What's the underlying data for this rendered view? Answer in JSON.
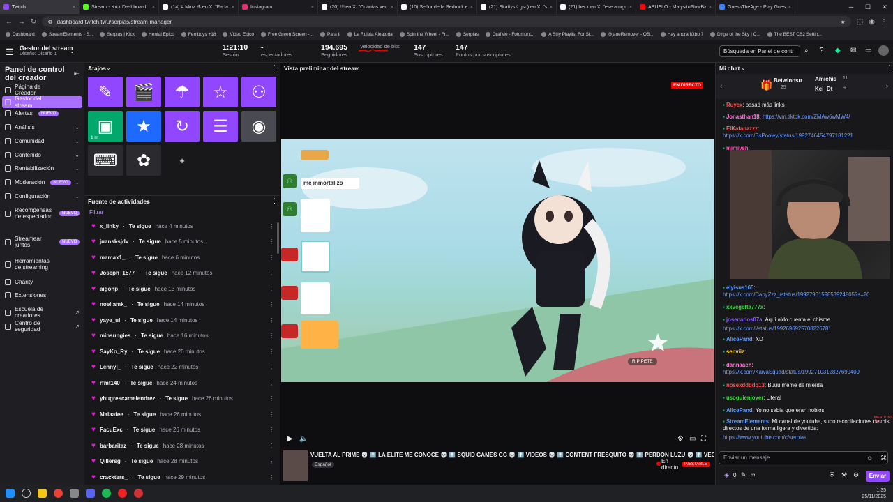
{
  "browser": {
    "tabs": [
      {
        "title": "Twitch",
        "color": "#9147ff",
        "active": true
      },
      {
        "title": "Stream - Kick Dashboard",
        "color": "#53fc18"
      },
      {
        "title": "(14) # Miriz ᴹᴸ en X: \"Farfa",
        "color": "#ffffff"
      },
      {
        "title": "Instagram",
        "color": "#e1306c"
      },
      {
        "title": "(20) ᵀᴴ en X: \"Cuántas vec",
        "color": "#ffffff"
      },
      {
        "title": "(10) Señor de la Bedrock en X",
        "color": "#ffffff"
      },
      {
        "title": "(21) Skattys ᵒ gsc) en X: \"sp",
        "color": "#ffffff"
      },
      {
        "title": "(21) beck en X: \"ese amigo m",
        "color": "#ffffff"
      },
      {
        "title": "ABUELO - MatysitoFlowBaks",
        "color": "#ff0000"
      },
      {
        "title": "GuessTheAge - Play Guess Th",
        "color": "#3b82f6"
      }
    ],
    "url": "dashboard.twitch.tv/u/serpias/stream-manager",
    "bookmarks": [
      "Dashboard",
      "StreamElements - S...",
      "Serpias | Kick",
      "Hentai Epico",
      "Femboys +18",
      "Video Epico",
      "Free Green Screen -...",
      "Para ti",
      "La Ruleta Aleatoria",
      "Spin the Wheel - Fr...",
      "Serpias",
      "GrafMe - Fotomont...",
      "A Silly Playlist For Si...",
      "@janeRemover - OB...",
      "Hay ahora fútbol?",
      "Dirge of the Sky | C...",
      "The BEST CS2 Settin..."
    ]
  },
  "topbar": {
    "title": "Gestor del stream",
    "subtitle": "Diseño: Diseño 1",
    "stats": [
      {
        "value": "1:21:10",
        "label": "Sesión"
      },
      {
        "value": "-",
        "label": "espectadores"
      },
      {
        "value": "194.695",
        "label": "Seguidores"
      },
      {
        "value": "",
        "label": "Velocidad de bits"
      },
      {
        "value": "147",
        "label": "Suscriptores"
      },
      {
        "value": "147",
        "label": "Puntos por suscriptores"
      }
    ],
    "search_placeholder": "Búsqueda en Panel de contr"
  },
  "sidebar": {
    "title": "Panel de control del creador",
    "items": [
      {
        "label": "Página de Creador"
      },
      {
        "label": "Gestor del stream",
        "active": true
      },
      {
        "label": "Alertas",
        "badge": "NUEVO"
      },
      {
        "label": "Análisis",
        "chevron": true
      },
      {
        "label": "Comunidad",
        "chevron": true
      },
      {
        "label": "Contenido",
        "chevron": true
      },
      {
        "label": "Rentabilización",
        "chevron": true
      },
      {
        "label": "Moderación",
        "badge": "NUEVO",
        "chevron": true
      },
      {
        "label": "Configuración",
        "chevron": true
      },
      {
        "label": "Recompensas de espectador",
        "badge": "NUEVO",
        "chevron": true
      },
      {
        "label": "Streamear juntos",
        "badge": "NUEVO"
      },
      {
        "label": "Herramientas de streaming"
      },
      {
        "label": "Charity"
      },
      {
        "label": "Extensiones"
      },
      {
        "label": "Escuela de creadores",
        "external": true
      },
      {
        "label": "Centro de seguridad",
        "external": true
      }
    ]
  },
  "shortcuts": {
    "title": "Atajos",
    "tiles": [
      {
        "icon": "pencil-icon",
        "glyph": "✎",
        "color": "#9147ff"
      },
      {
        "icon": "clapperboard-icon",
        "glyph": "🎬",
        "color": "#9147ff"
      },
      {
        "icon": "parachute-icon",
        "glyph": "☂",
        "color": "#9147ff"
      },
      {
        "icon": "star-outline-icon",
        "glyph": "☆",
        "color": "#9147ff"
      },
      {
        "icon": "add-user-icon",
        "glyph": "⚇",
        "color": "#9147ff"
      },
      {
        "icon": "ad-icon",
        "glyph": "▣",
        "color": "#00a86b",
        "caption": "1 m"
      },
      {
        "icon": "star-icon",
        "glyph": "★",
        "color": "#1e69ff"
      },
      {
        "icon": "restart-icon",
        "glyph": "↻",
        "color": "#9147ff"
      },
      {
        "icon": "layout-icon",
        "glyph": "☰",
        "color": "#9147ff"
      },
      {
        "icon": "podcast-icon",
        "glyph": "◉",
        "color": "#4a4a52"
      },
      {
        "icon": "chat-bot-icon",
        "glyph": "⌨",
        "color": "#2a2a2f"
      },
      {
        "icon": "kick-extension-icon",
        "glyph": "✿",
        "color": "#2a2a2f"
      }
    ],
    "add_label": "+"
  },
  "activity": {
    "title": "Fuente de actividades",
    "filter": "Filtrar",
    "events": [
      {
        "user": "x_linky",
        "action": "Te sigue",
        "time": "hace 4 minutos"
      },
      {
        "user": "juansksjdv",
        "action": "Te sigue",
        "time": "hace 5 minutos"
      },
      {
        "user": "mamax1_",
        "action": "Te sigue",
        "time": "hace 6 minutos"
      },
      {
        "user": "Joseph_1577",
        "action": "Te sigue",
        "time": "hace 12 minutos"
      },
      {
        "user": "aigohp",
        "action": "Te sigue",
        "time": "hace 13 minutos"
      },
      {
        "user": "noeliamk_",
        "action": "Te sigue",
        "time": "hace 14 minutos"
      },
      {
        "user": "yaye_ul",
        "action": "Te sigue",
        "time": "hace 14 minutos"
      },
      {
        "user": "minsungies",
        "action": "Te sigue",
        "time": "hace 16 minutos"
      },
      {
        "user": "SayKo_Ry",
        "action": "Te sigue",
        "time": "hace 20 minutos"
      },
      {
        "user": "Lennyl_",
        "action": "Te sigue",
        "time": "hace 22 minutos"
      },
      {
        "user": "rfmt140",
        "action": "Te sigue",
        "time": "hace 24 minutos"
      },
      {
        "user": "yhugrescamelendrez",
        "action": "Te sigue",
        "time": "hace 26 minutos"
      },
      {
        "user": "Malaafee",
        "action": "Te sigue",
        "time": "hace 26 minutos"
      },
      {
        "user": "FacuExc",
        "action": "Te sigue",
        "time": "hace 26 minutos"
      },
      {
        "user": "barbaritaz",
        "action": "Te sigue",
        "time": "hace 28 minutos"
      },
      {
        "user": "Qillersg",
        "action": "Te sigue",
        "time": "hace 28 minutos"
      },
      {
        "user": "crackters_",
        "action": "Te sigue",
        "time": "hace 29 minutos"
      }
    ]
  },
  "preview": {
    "title": "Vista preliminar del stream",
    "live_badge": "EN DIRECTO",
    "overlay_text": "me inmortalizo",
    "rip_text": "RIP PETE",
    "stream_title": "VUELTA AL PRIME 💀 ⬆️ LA ELITE ME CONOCE 💀 ⬆️ SQUID GAMES GG 💀 ⬆️ VIDEOS 💀 ⬆️ CONTENT FRESQUITO 💀 ⬆️ PERDON LUZU 💀 ⬆️ VEGETTA M",
    "language": "Español",
    "status": "En directo",
    "unstable": "INESTABLE"
  },
  "chat": {
    "title": "Mi chat",
    "gifters": [
      {
        "name": "Betwinosu",
        "count": "25"
      },
      {
        "name": "Amichis",
        "count": "11"
      },
      {
        "name": "Kei_Dt",
        "count": "9"
      }
    ],
    "messages": [
      {
        "user": "Ruycx",
        "color": "#ff4f4f",
        "text": "pasad más links"
      },
      {
        "user": "Jonasthan18",
        "color": "#ff7ad9",
        "text": "https://vm.tiktok.com/ZMAw6wMW4/",
        "link": true
      },
      {
        "user": "ElKatanazzz",
        "color": "#ff6b6b",
        "text": "https://x.com/BsPooley/status/1992746454797181221",
        "link": true
      },
      {
        "user": "mimivsh",
        "color": "#ff4fb1",
        "text": ""
      },
      {
        "user": "elyisus165",
        "color": "#5c9dff",
        "text": "https://x.com/CapyZzz_/status/1992796159853924805?s=20",
        "link": true
      },
      {
        "user": "xxvegetta777x",
        "color": "#3ad63a",
        "text": ""
      },
      {
        "user": "josecarlos07a",
        "color": "#8a5cff",
        "text": "Aquí aldo cuenta el chisme"
      },
      {
        "user": "",
        "color": "#ffffff",
        "text": "https://x.com/i/status/1992696925708226781",
        "link": true
      },
      {
        "user": "AlicePand",
        "color": "#5c9dff",
        "text": "XD"
      },
      {
        "user": "senviiz",
        "color": "#ffd23f",
        "text": ""
      },
      {
        "user": "dannaaeh",
        "color": "#ff7ad9",
        "text": "https://x.com/KaivaSquad/status/1992710312827699409",
        "link": true
      },
      {
        "user": "nosexddddq13",
        "color": "#ff4f4f",
        "text": "Buuu meme de mierda"
      },
      {
        "user": "usoguienjoyer",
        "color": "#3ad63a",
        "text": "Literal"
      },
      {
        "user": "AlicePand",
        "color": "#5c9dff",
        "text": "Yo no sabia que eran nobios"
      },
      {
        "user": "StreamElements",
        "color": "#5c9dff",
        "text": "Mi canal de youtube, subo recopilaciones de mis directos de una forma ligera y divertida:"
      },
      {
        "user": "",
        "color": "#ffffff",
        "text": "https://www.youtube.com/c/serpias",
        "link": true
      }
    ],
    "mention_tag": "MENTIONS YOU",
    "input_placeholder": "Enviar un mensaje",
    "points": "0",
    "send_label": "Enviar"
  },
  "taskbar": {
    "time": "1:35",
    "date": "25/11/2025"
  }
}
